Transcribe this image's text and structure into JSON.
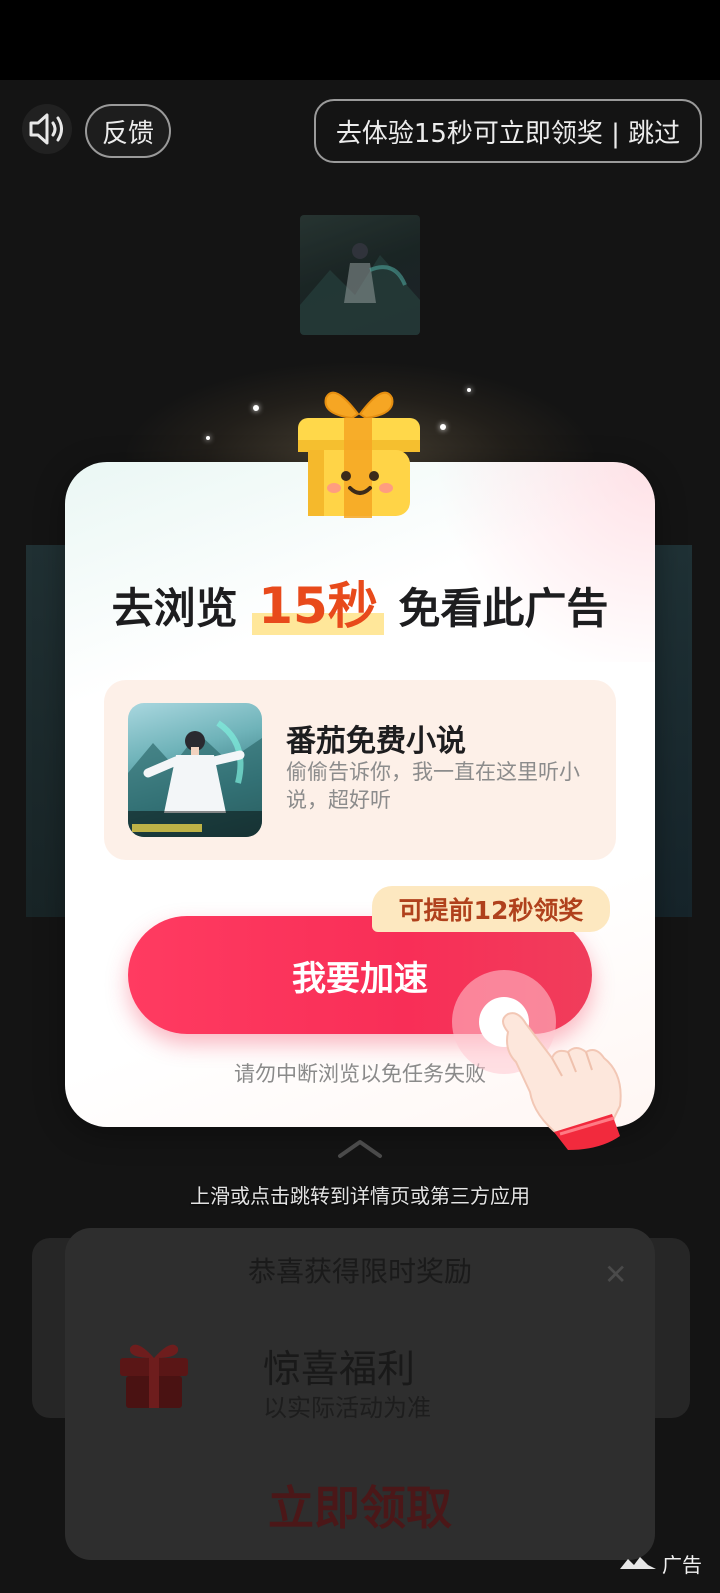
{
  "header": {
    "feedback_label": "反馈",
    "skip_label": "去体验15秒可立即领奖 | 跳过"
  },
  "card": {
    "title_prefix": "去浏览",
    "title_highlight": "15秒",
    "title_suffix": "免看此广告",
    "app": {
      "name": "番茄免费小说",
      "description": "偷偷告诉你，我一直在这里听小说，超好听"
    },
    "bonus_tag": "可提前12秒领奖",
    "accelerate_label": "我要加速",
    "warning": "请勿中断浏览以免任务失败"
  },
  "hint": "上滑或点击跳转到详情页或第三方应用",
  "reward_popup": {
    "title": "恭喜获得限时奖励",
    "name": "惊喜福利",
    "subtitle": "以实际活动为准",
    "claim_label": "立即领取"
  },
  "ad_label": "广告",
  "colors": {
    "accent": "#ff3b61",
    "highlight": "#e84a1b",
    "bonus_bg": "#fde8c0"
  }
}
